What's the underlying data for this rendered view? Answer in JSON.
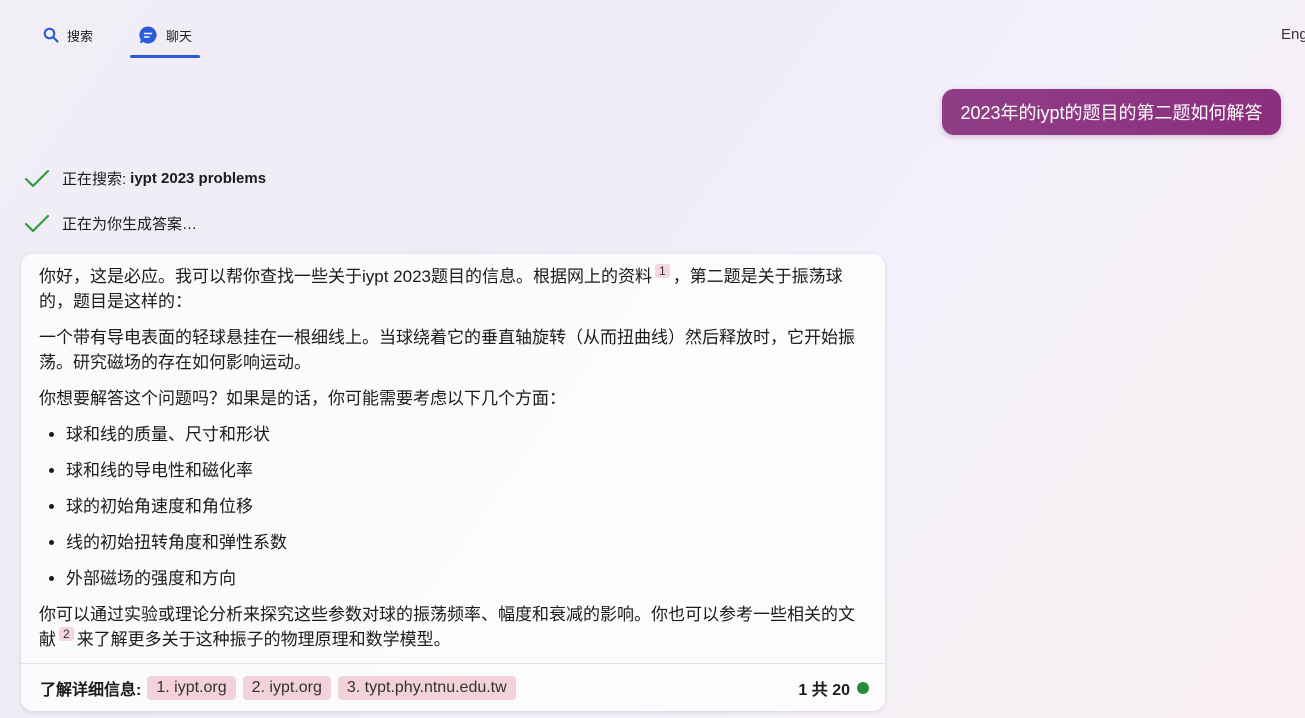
{
  "nav": {
    "tabs": [
      {
        "label": "搜索",
        "icon": "search-icon"
      },
      {
        "label": "聊天",
        "icon": "chat-icon"
      }
    ],
    "language": "Eng"
  },
  "user_message": "2023年的iypt的题目的第二题如何解答",
  "status": {
    "searching_prefix": "正在搜索:",
    "searching_query": "iypt 2023 problems",
    "generating": "正在为你生成答案…"
  },
  "answer": {
    "p1_a": "你好，这是必应。我可以帮你查找一些关于iypt 2023题目的信息。根据网上的资料",
    "p1_ref": "1",
    "p1_b": "，第二题是关于振荡球的，题目是这样的：",
    "p2": "一个带有导电表面的轻球悬挂在一根细线上。当球绕着它的垂直轴旋转（从而扭曲线）然后释放时，它开始振荡。研究磁场的存在如何影响运动。",
    "p3": "你想要解答这个问题吗？如果是的话，你可能需要考虑以下几个方面：",
    "bullets": [
      "球和线的质量、尺寸和形状",
      "球和线的导电性和磁化率",
      "球的初始角速度和角位移",
      "线的初始扭转角度和弹性系数",
      "外部磁场的强度和方向"
    ],
    "p4_a": "你可以通过实验或理论分析来探究这些参数对球的振荡频率、幅度和衰减的影响。你也可以参考一些相关的文献",
    "p4_ref": "2",
    "p4_b": "来了解更多关于这种振子的物理原理和数学模型。"
  },
  "footer": {
    "label": "了解详细信息:",
    "links": [
      "1. iypt.org",
      "2. iypt.org",
      "3. typt.phy.ntnu.edu.tw"
    ],
    "counter": "1 共 20"
  },
  "colors": {
    "accent_blue": "#2a5ad7",
    "user_bubble": "#8c2f7e",
    "check_green": "#2e9e3e",
    "chip_pink": "#f3d2d9",
    "status_dot": "#2a8a3c"
  }
}
